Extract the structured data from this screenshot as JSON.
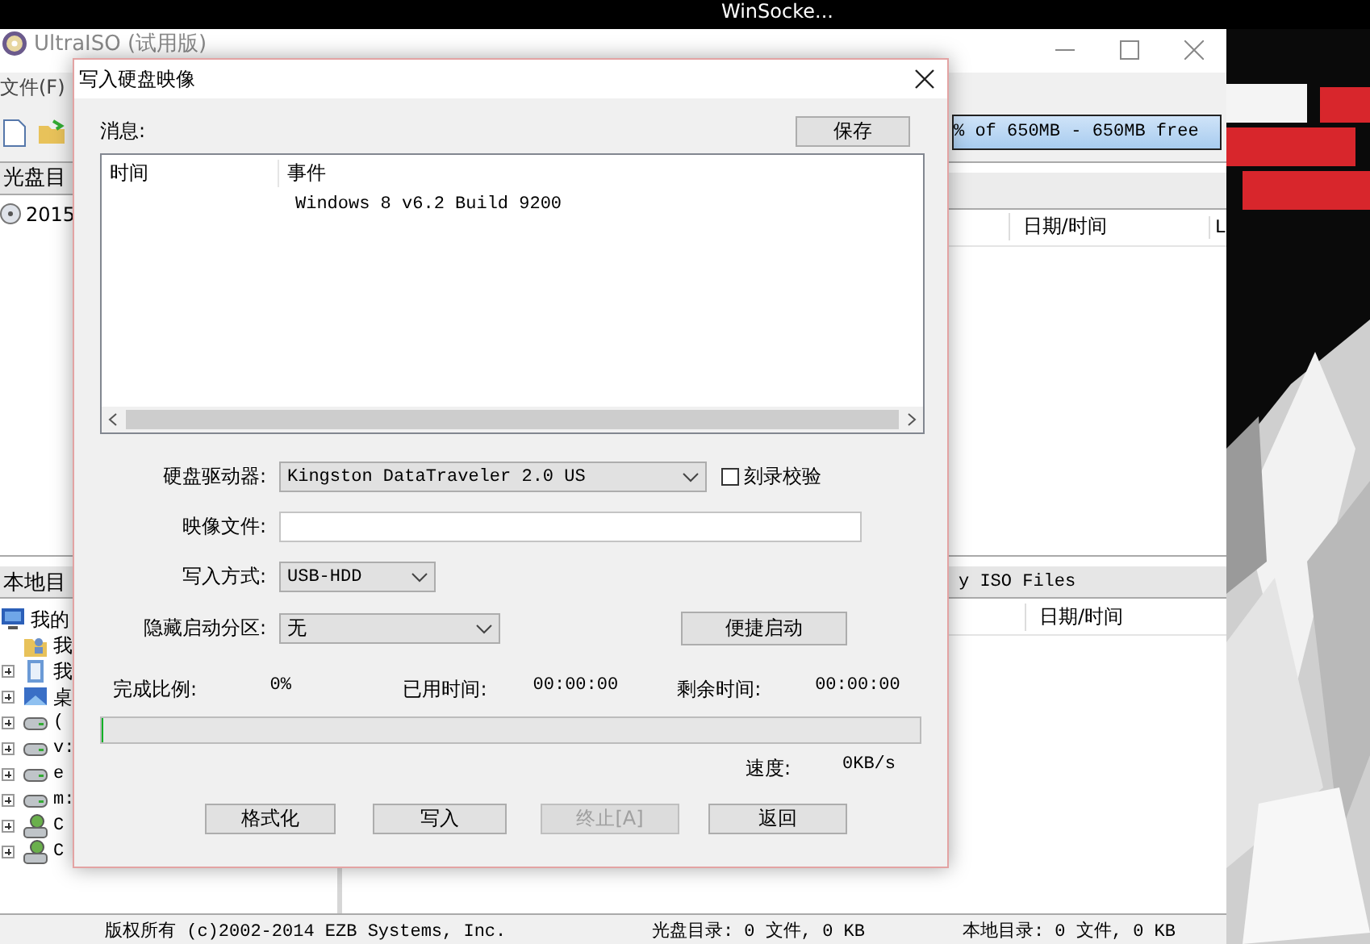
{
  "top_bar": {
    "text": "WinSocke..."
  },
  "main_window": {
    "title": "UltraISO (试用版)",
    "menu": [
      "文件(F)"
    ],
    "capacity": "% of 650MB - 650MB free",
    "iso_pane": {
      "header": "光盘目",
      "items": [
        {
          "label": "2015"
        }
      ]
    },
    "iso_files": {
      "columns": [
        "日期/时间",
        "L"
      ]
    },
    "local_pane": {
      "header": "本地目",
      "tree": [
        {
          "label": "我的",
          "kind": "computer",
          "expandable": false,
          "children": [
            {
              "label": "我",
              "kind": "user-folder",
              "expandable": false
            },
            {
              "label": "我",
              "kind": "documents",
              "expandable": true
            },
            {
              "label": "桌",
              "kind": "desktop",
              "expandable": true
            },
            {
              "label": "(",
              "kind": "drive",
              "expandable": true
            },
            {
              "label": "v:",
              "kind": "drive",
              "expandable": true
            },
            {
              "label": "e",
              "kind": "drive",
              "expandable": true
            },
            {
              "label": "m:",
              "kind": "drive",
              "expandable": true
            },
            {
              "label": "C",
              "kind": "network-drive",
              "expandable": true
            },
            {
              "label": "C",
              "kind": "network-drive",
              "expandable": true
            }
          ]
        }
      ]
    },
    "local_files": {
      "header": "y ISO Files",
      "columns": [
        "日期/时间"
      ]
    },
    "status_bar": [
      "版权所有 (c)2002-2014 EZB Systems, Inc.",
      "光盘目录: 0 文件, 0 KB",
      "本地目录: 0 文件, 0 KB"
    ]
  },
  "dialog": {
    "title": "写入硬盘映像",
    "messages_label": "消息:",
    "save_button": "保存",
    "log": {
      "columns": [
        "时间",
        "事件"
      ],
      "rows": [
        [
          "",
          "Windows 8 v6.2 Build 9200"
        ]
      ]
    },
    "drive": {
      "label": "硬盘驱动器:",
      "value": "Kingston DataTraveler 2.0 US"
    },
    "verify": {
      "label": "刻录校验",
      "checked": false
    },
    "image_file": {
      "label": "映像文件:"
    },
    "write_method": {
      "label": "写入方式:",
      "value": "USB-HDD"
    },
    "hide_partition": {
      "label": "隐藏启动分区:",
      "value": "无"
    },
    "quick_boot_button": "便捷启动",
    "stats": [
      {
        "label": "完成比例:",
        "value": "0%"
      },
      {
        "label": "已用时间:",
        "value": "00:00:00"
      },
      {
        "label": "剩余时间:",
        "value": "00:00:00"
      }
    ],
    "progress": {
      "level": 0
    },
    "speed": {
      "label": "速度:",
      "value": "0KB/s"
    },
    "buttons": [
      {
        "label": "格式化",
        "disabled": false
      },
      {
        "label": "写入",
        "disabled": false
      },
      {
        "label": "终止[A]",
        "disabled": true
      },
      {
        "label": "返回",
        "disabled": false
      }
    ]
  }
}
